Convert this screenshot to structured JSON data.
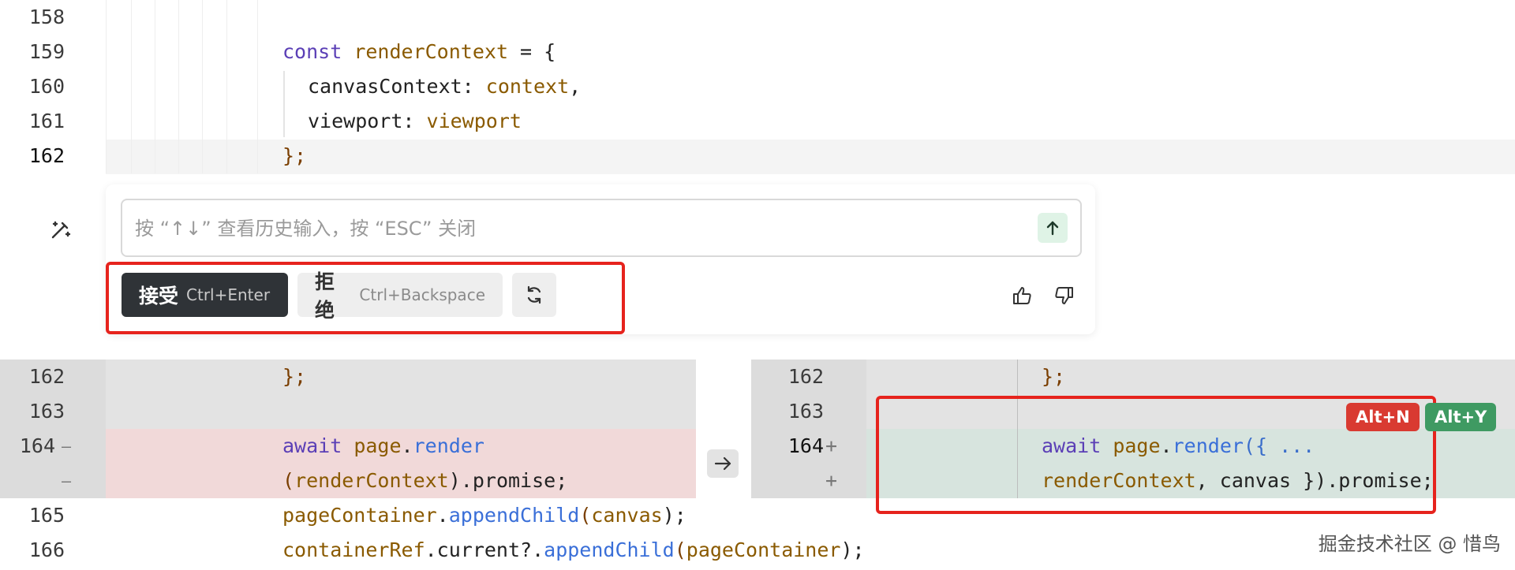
{
  "top_lines": [
    {
      "num": "158"
    },
    {
      "num": "159"
    },
    {
      "num": "160"
    },
    {
      "num": "161"
    },
    {
      "num": "162"
    }
  ],
  "code_text": {
    "l159_kw": "const",
    "l159_id": "renderContext",
    "l159_rest": " = {",
    "l160_prop": "canvasContext: ",
    "l160_val": "context",
    "l160_end": ",",
    "l161_prop": "viewport: ",
    "l161_val": "viewport",
    "l162": "};"
  },
  "widget": {
    "placeholder": "按 “↑↓” 查看历史输入，按 “ESC” 关闭",
    "accept_label": "接受",
    "accept_shortcut": "Ctrl+Enter",
    "reject_label": "拒绝",
    "reject_shortcut": "Ctrl+Backspace",
    "icons": [
      "magic-wand-icon",
      "arrow-up-icon",
      "refresh-icon",
      "thumbs-up-icon",
      "thumbs-down-icon"
    ]
  },
  "diff": {
    "left": {
      "nums": [
        "162",
        "163",
        "164"
      ],
      "minus_marks": [
        "—",
        "—"
      ],
      "l162": "};",
      "l164a_kw": "await",
      "l164a_id": "page",
      "l164a_dot": ".",
      "l164a_fn": "render",
      "l164b_open": "(",
      "l164b_id": "renderContext",
      "l164b_rest": ").promise;"
    },
    "right": {
      "nums": [
        "162",
        "163",
        "164"
      ],
      "plus_marks": [
        "+",
        "+"
      ],
      "l162": "};",
      "l164a_kw": "await",
      "l164a_id": "page",
      "l164a_dot": ".",
      "l164a_fn": "render",
      "l164a_rest": "({ ...",
      "l164b_id": "renderContext",
      "l164b_rest": ", canvas }).promise;"
    },
    "arrow_icon": "arrow-right-icon",
    "shortcut_reject": "Alt+N",
    "shortcut_accept": "Alt+Y"
  },
  "bottom_lines": [
    {
      "num": "165",
      "obj": "pageContainer",
      "dot": ".",
      "fn": "appendChild",
      "open": "(",
      "arg": "canvas",
      "close": ");"
    },
    {
      "num": "166",
      "obj": "containerRef",
      "dot": ".current?.",
      "fn": "appendChild",
      "open": "(",
      "arg": "pageContainer",
      "close": ");"
    }
  ],
  "watermark": "掘金技术社区 @ 惜鸟",
  "colors": {
    "accept_bg": "#2f3337",
    "reject_bg": "#eeeeee",
    "highlight_red": "#e6231d",
    "alt_n": "#d93a31",
    "alt_y": "#3f9a62",
    "removed_bg": "#f1d9d9",
    "added_bg": "#d7e4de"
  }
}
